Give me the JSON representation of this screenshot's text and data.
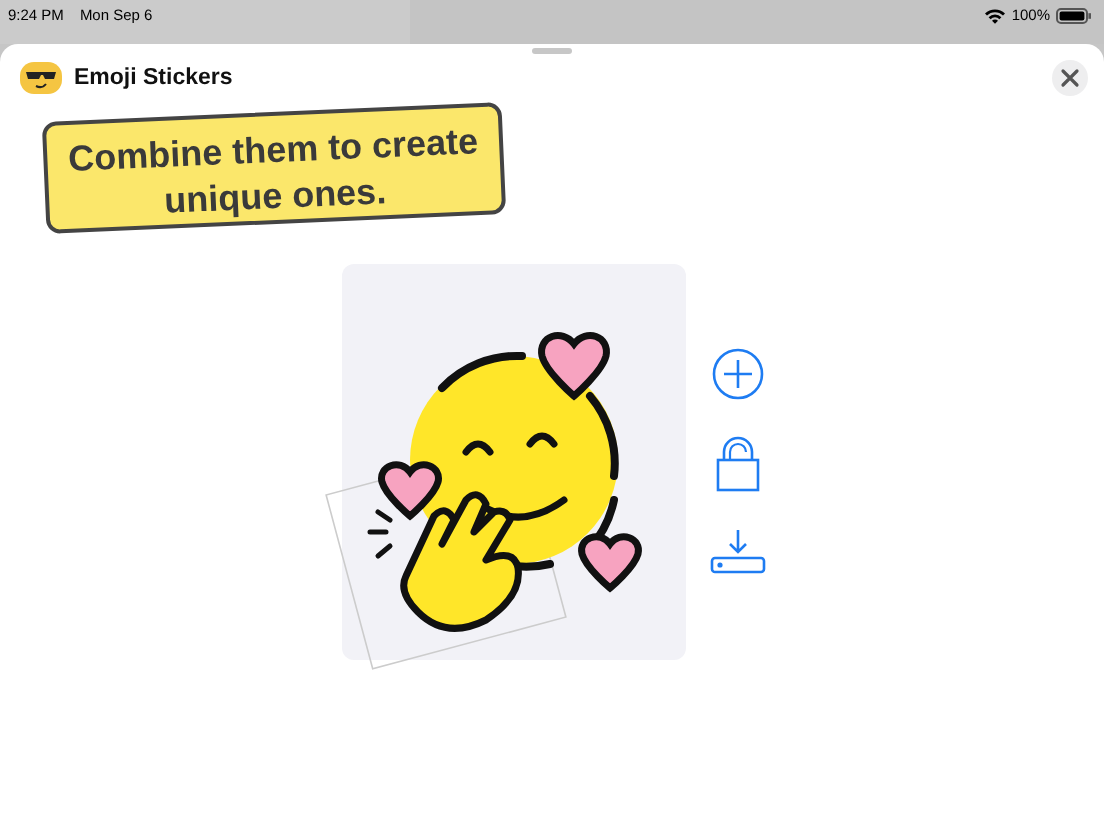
{
  "status_bar": {
    "time": "9:24 PM",
    "date": "Mon Sep 6",
    "battery": "100%"
  },
  "sheet": {
    "title": "Emoji Stickers"
  },
  "banner": {
    "text": "Combine them to create unique ones."
  }
}
